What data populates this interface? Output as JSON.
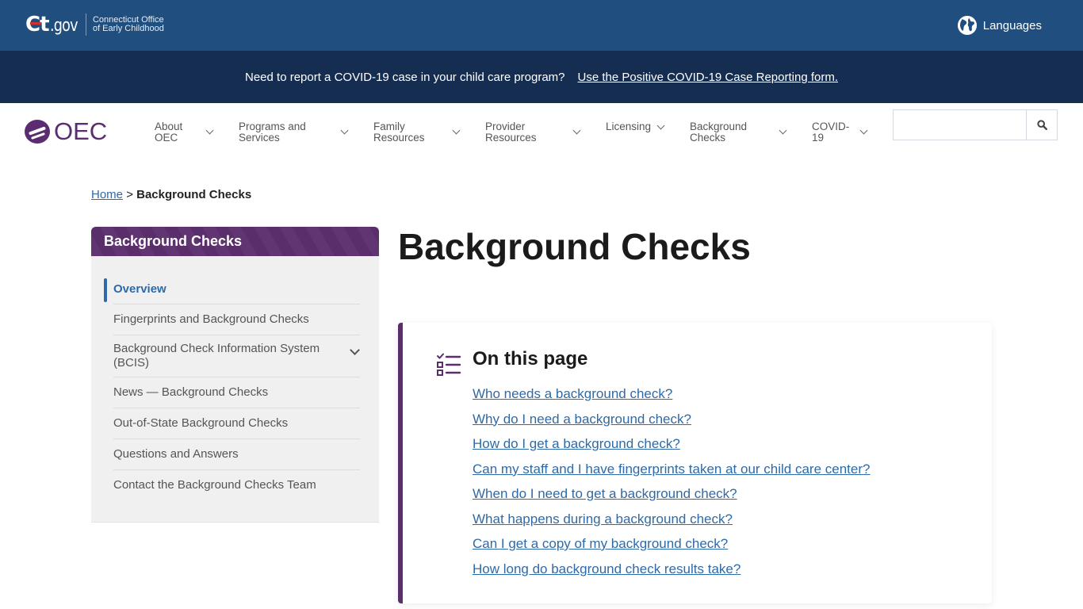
{
  "topbar": {
    "ct_logo_main": "Ct",
    "ct_logo_suffix": ".gov",
    "office_line1": "Connecticut Office",
    "office_line2": "of Early Childhood",
    "languages_label": "Languages"
  },
  "covid_banner": {
    "question": "Need to report a COVID-19 case in your child care program?",
    "link_label": "Use the Positive COVID-19 Case Reporting form."
  },
  "nav": {
    "logo_text": "OEC",
    "items": [
      {
        "line1": "About",
        "line2": "OEC"
      },
      {
        "line1": "Programs and",
        "line2": "Services"
      },
      {
        "line1": "Family",
        "line2": "Resources"
      },
      {
        "line1": "Provider",
        "line2": "Resources"
      },
      {
        "line1": "Licensing",
        "line2": ""
      },
      {
        "line1": "Background",
        "line2": "Checks"
      },
      {
        "line1": "COVID-",
        "line2": "19"
      }
    ],
    "search": {
      "value": "",
      "placeholder": ""
    }
  },
  "breadcrumb": {
    "home": "Home",
    "separator": ">",
    "current": "Background Checks"
  },
  "sidebar": {
    "title": "Background Checks",
    "items": [
      {
        "label": "Overview",
        "active": true
      },
      {
        "label": "Fingerprints and Background Checks"
      },
      {
        "label": "Background Check Information System (BCIS)",
        "expandable": true
      },
      {
        "label": "News — Background Checks"
      },
      {
        "label": "Out-of-State Background Checks"
      },
      {
        "label": "Questions and Answers"
      },
      {
        "label": "Contact the Background Checks Team"
      }
    ]
  },
  "main": {
    "title": "Background Checks",
    "toc": {
      "title": "On this page",
      "links": [
        "Who needs a background check?",
        "Why do I need a background check?",
        "How do I get a background check?",
        "Can my staff and I have fingerprints taken at our child care center?",
        "When do I need to get a background check?",
        "What happens during a background check?",
        "Can I get a copy of my background check?",
        "How long do background check results take?"
      ]
    }
  },
  "colors": {
    "ctgov_blue": "#1f4e7f",
    "banner_navy": "#162d52",
    "oec_purple": "#5a2d6b",
    "link_blue": "#2e6aa8"
  }
}
